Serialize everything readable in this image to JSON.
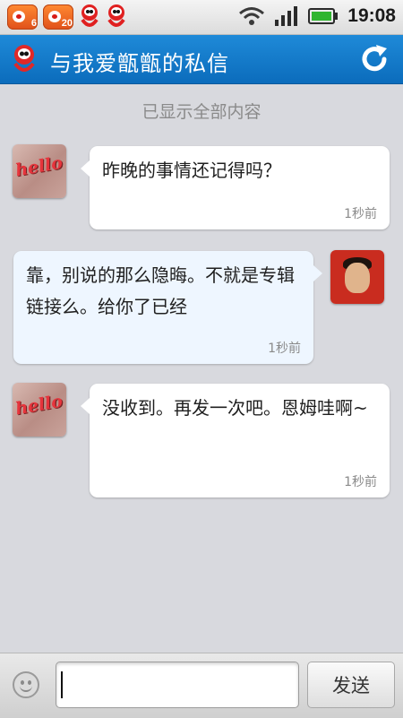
{
  "status_bar": {
    "time": "19:08",
    "notifications": [
      {
        "app": "weibo",
        "count": "6"
      },
      {
        "app": "weibo",
        "count": "20"
      }
    ],
    "icons": [
      "weibo-mascot-icon",
      "weibo-mascot-icon",
      "wifi-icon",
      "signal-icon",
      "battery-icon"
    ]
  },
  "header": {
    "title": "与我爱甑甑的私信",
    "logo_icon": "weibo-logo-icon",
    "refresh_icon": "refresh-icon",
    "accent_color": "#1a7fd0"
  },
  "conversation": {
    "status_note": "已显示全部内容",
    "messages": [
      {
        "direction": "incoming",
        "avatar": "hello-avatar",
        "text": "昨晚的事情还记得吗？",
        "time": "1秒前"
      },
      {
        "direction": "outgoing",
        "avatar": "user-photo-avatar",
        "text": "靠，别说的那么隐晦。不就是专辑链接么。给你了已经",
        "time": "1秒前"
      },
      {
        "direction": "incoming",
        "avatar": "hello-avatar",
        "text": "没收到。再发一次吧。恩姆哇啊~",
        "time": "1秒前"
      }
    ]
  },
  "input_bar": {
    "emoji_icon": "smiley-icon",
    "input_value": "",
    "send_label": "发送"
  }
}
